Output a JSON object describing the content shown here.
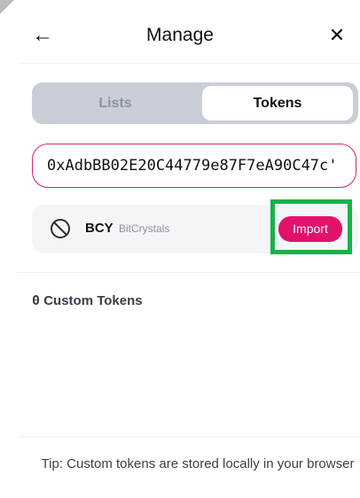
{
  "header": {
    "back_icon": "arrow-left-icon",
    "back_glyph": "←",
    "title": "Manage",
    "close_icon": "close-icon",
    "close_glyph": "✕"
  },
  "tabs": [
    {
      "label": "Lists",
      "active": false
    },
    {
      "label": "Tokens",
      "active": true
    }
  ],
  "search": {
    "value": "0xAdbBB02E20C44779e87F7eA90C47c'"
  },
  "token": {
    "logo_icon": "unknown-token-icon",
    "symbol": "BCY",
    "name": "BitCrystals",
    "import_label": "Import"
  },
  "custom_tokens": {
    "count": "0",
    "label": "Custom Tokens"
  },
  "tip": "Tip: Custom tokens are stored locally in your browser",
  "colors": {
    "accent": "#e2126b",
    "input_border": "#d6246e",
    "highlight": "#18b148",
    "tabs_bg": "#c9ced6",
    "row_bg": "#f4f5f7"
  }
}
